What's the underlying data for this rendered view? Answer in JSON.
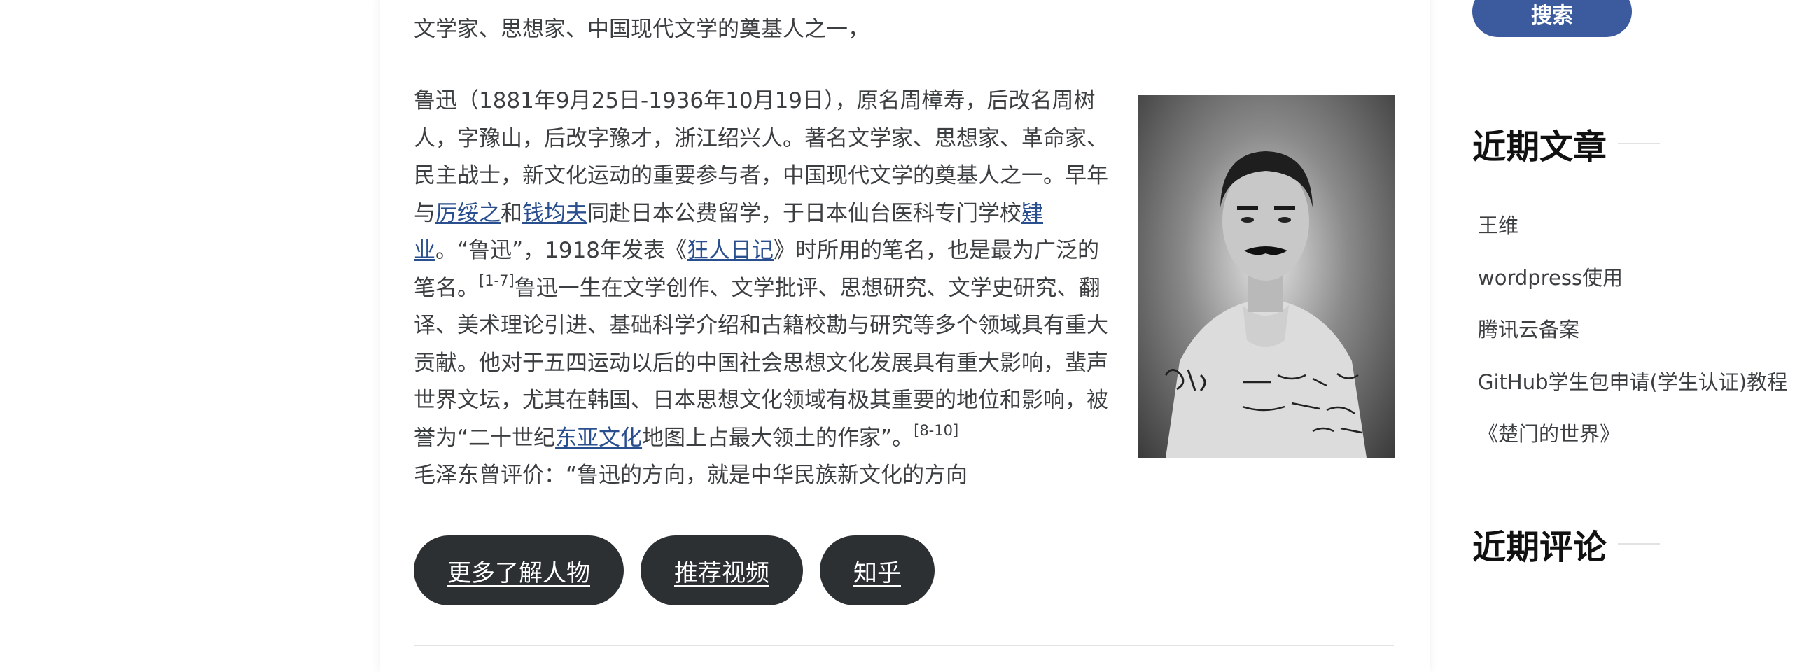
{
  "article": {
    "intro_line": "文学家、思想家、中国现代文学的奠基人之一，",
    "bio": {
      "p1": "鲁迅（1881年9月25日-1936年10月19日），原名周樟寿，后改名周树人，字豫山，后改字豫才，浙江绍兴人。著名文学家、思想家、革命家、民主战士，新文化运动的重要参与者，中国现代文学的奠基人之一。早年与",
      "link1": "厉绥之",
      "p2": "和",
      "link2": "钱均夫",
      "p3": "同赴日本公费留学，于日本仙台医科专门学校",
      "link3": "肄业",
      "p4": "。“鲁迅”，1918年发表《",
      "link4": "狂人日记",
      "p5": "》时所用的笔名，也是最为广泛的笔名。",
      "ref1": "[1-7]",
      "p6": "鲁迅一生在文学创作、文学批评、思想研究、文学史研究、翻译、美术理论引进、基础科学介绍和古籍校勘与研究等多个领域具有重大贡献。他对于五四运动以后的中国社会思想文化发展具有重大影响，蜚声世界文坛，尤其在韩国、日本思想文化领域有极其重要的地位和影响，被誉为“二十世纪",
      "link5": "东亚文化",
      "p7": "地图上占最大领土的作家”。",
      "ref2": "[8-10]",
      "p8": "毛泽东曾评价：“鲁迅的方向，就是中华民族新文化的方向"
    },
    "buttons": [
      "更多了解人物",
      "推荐视频",
      "知乎"
    ]
  },
  "sidebar": {
    "search_label": "搜索",
    "recent_posts_title": "近期文章",
    "recent_posts": [
      "王维",
      "wordpress使用",
      "腾讯云备案",
      "GitHub学生包申请(学生认证)教程",
      "《楚门的世界》"
    ],
    "recent_comments_title": "近期评论"
  },
  "colors": {
    "link": "#2a4f8f",
    "pill_button": "#2d3033",
    "search_button": "#3c5b9e"
  }
}
